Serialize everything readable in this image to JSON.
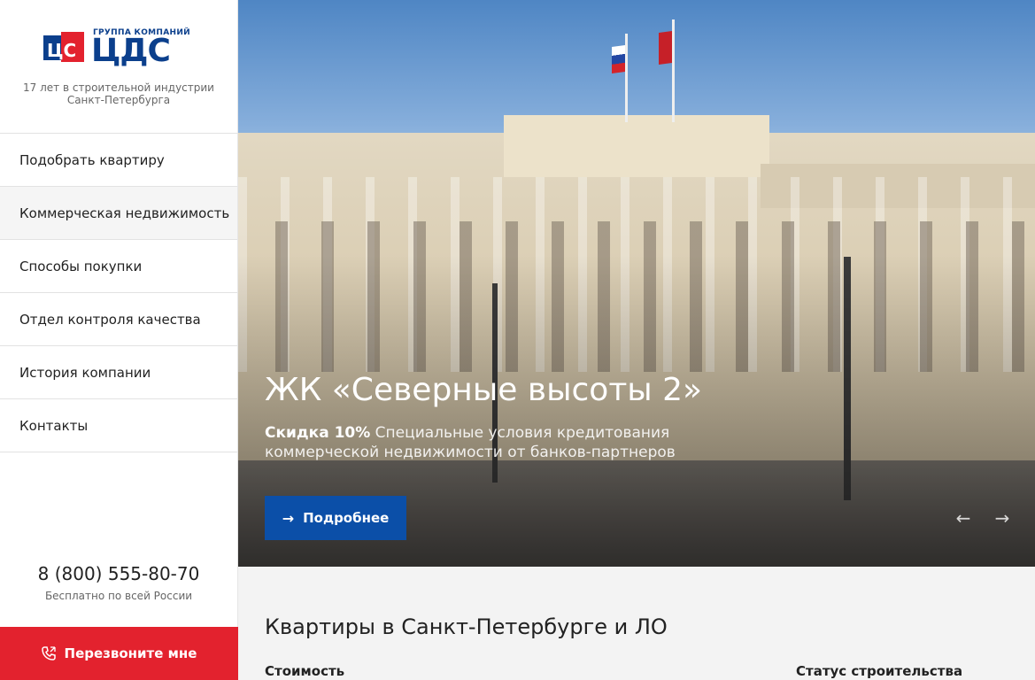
{
  "sidebar": {
    "logo": {
      "small_text": "ГРУППА  КОМПАНИЙ",
      "big_text": "ЦДС",
      "mark_text": "ЦС"
    },
    "tagline_line1": "17 лет в строительной индустрии",
    "tagline_line2": "Санкт-Петербурга",
    "menu": [
      {
        "label": "Подобрать квартиру"
      },
      {
        "label": "Коммерческая недвижимость"
      },
      {
        "label": "Способы покупки"
      },
      {
        "label": "Отдел контроля качества"
      },
      {
        "label": "История компании"
      },
      {
        "label": "Контакты"
      }
    ],
    "phone": "8 (800) 555-80-70",
    "phone_note": "Бесплатно по всей России",
    "callback_label": "Перезвоните мне"
  },
  "hero": {
    "title": "ЖК «Северные высоты 2»",
    "discount": "Скидка 10%",
    "subtitle": " Специальные условия кредитования коммерческой недвижимости от банков-партнеров",
    "button_label": "Подробнее",
    "prev_icon": "arrow-left-icon",
    "next_icon": "arrow-right-icon"
  },
  "section": {
    "title": "Квартиры в Санкт-Петербурге и ЛО",
    "filter_cost_label": "Стоимость",
    "filter_status_label": "Статус строительства"
  },
  "colors": {
    "accent_blue": "#0b4fa8",
    "accent_red": "#e3222e",
    "logo_blue": "#0b3f8c"
  }
}
